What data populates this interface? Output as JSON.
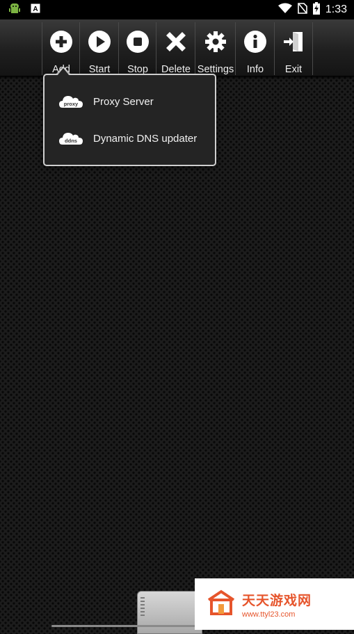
{
  "status_bar": {
    "time": "1:33",
    "left_icons": [
      "android-robot-icon",
      "a-notification-icon"
    ],
    "right_icons": [
      "wifi-icon",
      "no-sim-icon",
      "battery-charging-icon"
    ]
  },
  "toolbar": {
    "buttons": [
      {
        "label": "Add",
        "icon": "plus-circle-icon"
      },
      {
        "label": "Start",
        "icon": "play-icon"
      },
      {
        "label": "Stop",
        "icon": "stop-icon"
      },
      {
        "label": "Delete",
        "icon": "x-icon"
      },
      {
        "label": "Settings",
        "icon": "gear-icon"
      },
      {
        "label": "Info",
        "icon": "info-icon"
      },
      {
        "label": "Exit",
        "icon": "exit-door-icon"
      }
    ]
  },
  "add_menu": {
    "items": [
      {
        "label": "Proxy Server",
        "icon_text": "proxy",
        "icon": "proxy-cloud-icon"
      },
      {
        "label": "Dynamic DNS updater",
        "icon_text": "ddns",
        "icon": "ddns-cloud-icon"
      }
    ]
  },
  "watermark": {
    "name": "天天游戏网",
    "url": "www.ttyl23.com"
  },
  "colors": {
    "accent": "#e6552c",
    "toolbar": "#2a2a2a",
    "background": "#1c1c1c"
  }
}
